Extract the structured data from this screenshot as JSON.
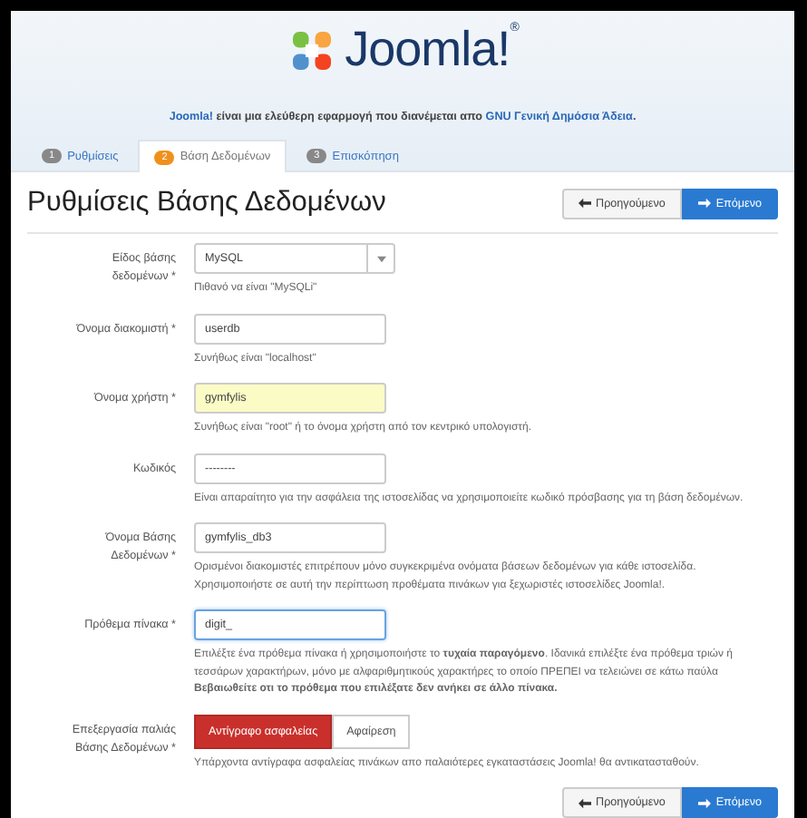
{
  "header": {
    "logo_text": "Joomla!",
    "logo_mark": "®"
  },
  "intro": {
    "link1": "Joomla!",
    "text": " είναι μια ελεύθερη εφαρμογή που διανέμεται απο ",
    "link2": "GNU Γενική Δημόσια Άδεια",
    "end": "."
  },
  "tabs": [
    {
      "number": "1",
      "label": "Ρυθμίσεις",
      "selected": false
    },
    {
      "number": "2",
      "label": "Βάση Δεδομένων",
      "selected": true
    },
    {
      "number": "3",
      "label": "Επισκόπηση",
      "selected": false
    }
  ],
  "title": "Ρυθμίσεις Βάσης Δεδομένων",
  "nav_top": {
    "previous": "Προηγούμενο",
    "next": "Επόμενο"
  },
  "fields": [
    {
      "kind": "select",
      "label": "Είδος βάσης δεδομένων *",
      "value": "MySQL",
      "hints": [
        "Πιθανό να είναι \"MySQLi\""
      ]
    },
    {
      "kind": "text",
      "label": "Όνομα διακομιστή *",
      "value": "userdb",
      "hints": [
        "Συνήθως είναι \"localhost\""
      ]
    },
    {
      "kind": "text",
      "label": "Όνομα χρήστη *",
      "value": "gymfylis",
      "hints": [
        "Συνήθως είναι \"root\" ή το όνομα χρήστη από τον κεντρικό υπολογιστή."
      ],
      "autofilled": true
    },
    {
      "kind": "text",
      "label": "Κωδικός",
      "value": "--------",
      "hints": [
        "Είναι απαραίτητο για την ασφάλεια της ιστοσελίδας να χρησιμοποιείτε κωδικό πρόσβασης για τη βάση δεδομένων."
      ]
    },
    {
      "kind": "text",
      "label": "Όνομα Βάσης Δεδομένων *",
      "value": "gymfylis_db3",
      "hints": [
        "Ορισμένοι διακομιστές επιτρέπουν μόνο συγκεκριμένα ονόματα βάσεων δεδομένων για κάθε ιστοσελίδα.",
        "Χρησιμοποιήστε σε αυτή την περίπτωση προθέματα πινάκων για ξεχωριστές ιστοσελίδες Joomla!."
      ]
    },
    {
      "kind": "text",
      "label": "Πρόθεμα πίνακα *",
      "value": "digit_",
      "hints": [
        "Επιλέξτε ένα πρόθεμα πίνακα ή χρησιμοποιήστε το **τυχαία παραγόμενο**. Ιδανικά επιλέξτε ένα πρόθεμα τριών ή τεσσάρων χαρακτήρων, μόνο με αλφαριθμητικούς χαρακτήρες το οποίο ΠΡΕΠΕΙ να τελειώνει σε κάτω παύλα **Βεβαιωθείτε οτι το πρόθεμα που επιλέξατε δεν ανήκει σε άλλο πίνακα.**"
      ],
      "focused": true
    },
    {
      "kind": "toggle",
      "label": "Επεξεργασία παλιάς Βάσης Δεδομένων *",
      "options": [
        {
          "label": "Αντίγραφο ασφαλείας",
          "selected": true
        },
        {
          "label": "Αφαίρεση",
          "selected": false
        }
      ],
      "hints": [
        "Υπάρχοντα αντίγραφα ασφαλείας πινάκων απο παλαιότερες εγκαταστάσεις Joomla! θα αντικατασταθούν."
      ]
    }
  ],
  "nav_bottom": {
    "previous": "Προηγούμενο",
    "next": "Επόμενο"
  }
}
